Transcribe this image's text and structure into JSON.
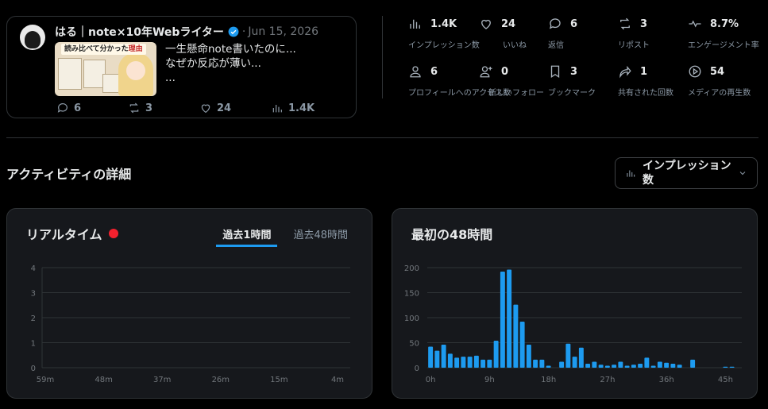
{
  "post": {
    "author": "はる｜note×10年Webライター",
    "date": "Jun 15, 2026",
    "dot": "·",
    "thumbnail_caption": "読み比べて分かった",
    "thumbnail_caption_red": "理由",
    "text_lines": [
      "一生懸命note書いたのに...",
      "なぜか反応が薄い...",
      "..."
    ],
    "actions": {
      "replies": "6",
      "reposts": "3",
      "likes": "24",
      "views": "1.4K"
    }
  },
  "metrics": [
    {
      "icon": "bar-chart-icon",
      "value": "1.4K",
      "label": "インプレッション数"
    },
    {
      "icon": "heart-icon",
      "value": "24",
      "label": "いいね"
    },
    {
      "icon": "reply-icon",
      "value": "6",
      "label": "返信"
    },
    {
      "icon": "repost-icon",
      "value": "3",
      "label": "リポスト"
    },
    {
      "icon": "pulse-icon",
      "value": "8.7%",
      "label": "エンゲージメント率"
    },
    {
      "icon": "profile-icon",
      "value": "6",
      "label": "プロフィールへのアクセス数"
    },
    {
      "icon": "follow-icon",
      "value": "0",
      "label": "新しいフォロー"
    },
    {
      "icon": "bookmark-icon",
      "value": "3",
      "label": "ブックマーク"
    },
    {
      "icon": "share-icon",
      "value": "1",
      "label": "共有された回数"
    },
    {
      "icon": "play-icon",
      "value": "54",
      "label": "メディアの再生数"
    }
  ],
  "activity": {
    "title": "アクティビティの詳細",
    "metric_select": "インプレッション数"
  },
  "realtime": {
    "title": "リアルタイム",
    "tabs": [
      "過去1時間",
      "過去48時間"
    ],
    "active_tab": 0
  },
  "first48": {
    "title": "最初の48時間"
  },
  "colors": {
    "accent": "#1d9bf0",
    "live": "#f4212e",
    "bar": "#1d9bf0"
  },
  "chart_data": [
    {
      "type": "line",
      "title": "リアルタイム",
      "x_ticks": [
        "59m",
        "48m",
        "37m",
        "26m",
        "15m",
        "4m"
      ],
      "y_ticks": [
        "0",
        "1",
        "2",
        "3",
        "4"
      ],
      "ylim": [
        0,
        4
      ],
      "series": [],
      "grid": true
    },
    {
      "type": "bar",
      "title": "最初の48時間",
      "x_ticks": [
        "0h",
        "9h",
        "18h",
        "27h",
        "36h",
        "45h"
      ],
      "y_ticks": [
        "0",
        "50",
        "100",
        "150",
        "200"
      ],
      "ylim": [
        0,
        200
      ],
      "x": [
        0,
        1,
        2,
        3,
        4,
        5,
        6,
        7,
        8,
        9,
        10,
        11,
        12,
        13,
        14,
        15,
        16,
        17,
        18,
        19,
        20,
        21,
        22,
        23,
        24,
        25,
        26,
        27,
        28,
        29,
        30,
        31,
        32,
        33,
        34,
        35,
        36,
        37,
        38,
        39,
        40,
        41,
        42,
        43,
        44,
        45,
        46,
        47
      ],
      "values": [
        42,
        34,
        46,
        28,
        20,
        22,
        22,
        24,
        16,
        16,
        54,
        192,
        196,
        126,
        92,
        46,
        16,
        16,
        4,
        0,
        12,
        48,
        22,
        40,
        8,
        12,
        6,
        4,
        6,
        12,
        4,
        6,
        8,
        20,
        4,
        12,
        10,
        8,
        6,
        0,
        16,
        0,
        0,
        0,
        0,
        2,
        2,
        0
      ],
      "grid": true
    }
  ]
}
